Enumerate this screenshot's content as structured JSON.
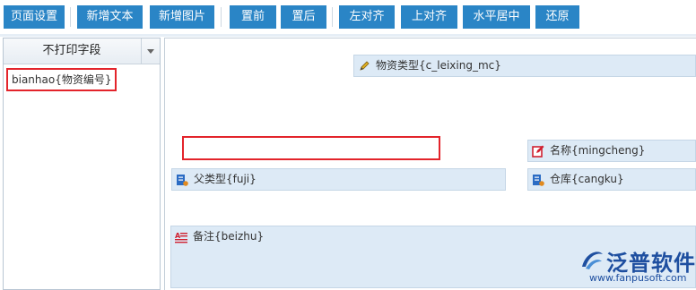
{
  "toolbar": {
    "buttons": [
      "页面设置",
      "新增文本",
      "新增图片",
      "置前",
      "置后",
      "左对齐",
      "上对齐",
      "水平居中",
      "还原"
    ]
  },
  "left_panel": {
    "title": "不打印字段",
    "items": [
      "bianhao{物资编号}"
    ]
  },
  "fields": {
    "wuzi_leixing": "物资类型{c_leixing_mc}",
    "mingcheng": "名称{mingcheng}",
    "fulei": "父类型{fuji}",
    "cangku": "仓库{cangku}",
    "beizhu": "备注{beizhu}"
  },
  "logo": {
    "name": "泛普软件",
    "url": "www.fanpusoft.com"
  },
  "colors": {
    "toolbar_button": "#2a85c6",
    "field_bg": "#ddeaf6",
    "highlight_border": "#e3242b",
    "logo_blue": "#1e4fa0"
  }
}
